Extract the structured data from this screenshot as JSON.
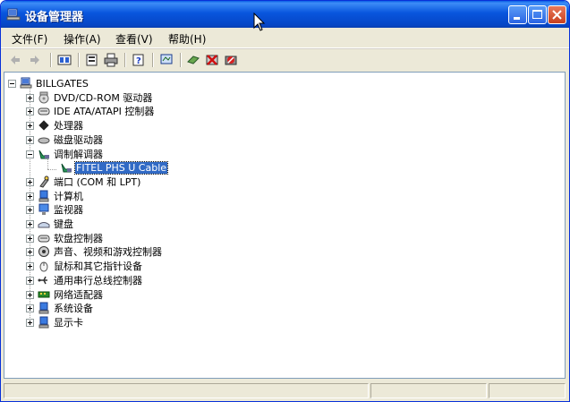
{
  "window": {
    "title": "设备管理器"
  },
  "menu": [
    {
      "label": "文件(F)"
    },
    {
      "label": "操作(A)"
    },
    {
      "label": "查看(V)"
    },
    {
      "label": "帮助(H)"
    }
  ],
  "toolbar": {
    "icons": [
      "back-icon",
      "forward-icon",
      "up-icon",
      "properties-icon",
      "print-icon",
      "help-icon",
      "scan-icon",
      "update-driver-icon",
      "uninstall-icon",
      "disable-icon"
    ]
  },
  "tree": {
    "root": "BILLGATES",
    "items": [
      {
        "label": "DVD/CD-ROM 驱动器",
        "icon": "cdrom-icon",
        "expander": "plus"
      },
      {
        "label": "IDE ATA/ATAPI 控制器",
        "icon": "ide-controller-icon",
        "expander": "plus"
      },
      {
        "label": "处理器",
        "icon": "processor-icon",
        "expander": "plus"
      },
      {
        "label": "磁盘驱动器",
        "icon": "disk-drive-icon",
        "expander": "plus"
      },
      {
        "label": "调制解调器",
        "icon": "modem-icon",
        "expander": "minus"
      },
      {
        "label": "FITEL PHS U Cable",
        "icon": "modem-icon",
        "expander": "none",
        "child": true,
        "selected": true
      },
      {
        "label": "端口 (COM 和 LPT)",
        "icon": "port-icon",
        "expander": "plus"
      },
      {
        "label": "计算机",
        "icon": "computer-icon",
        "expander": "plus"
      },
      {
        "label": "监视器",
        "icon": "monitor-icon",
        "expander": "plus"
      },
      {
        "label": "键盘",
        "icon": "keyboard-icon",
        "expander": "plus"
      },
      {
        "label": "软盘控制器",
        "icon": "floppy-controller-icon",
        "expander": "plus"
      },
      {
        "label": "声音、视频和游戏控制器",
        "icon": "sound-icon",
        "expander": "plus"
      },
      {
        "label": "鼠标和其它指针设备",
        "icon": "mouse-icon",
        "expander": "plus"
      },
      {
        "label": "通用串行总线控制器",
        "icon": "usb-icon",
        "expander": "plus"
      },
      {
        "label": "网络适配器",
        "icon": "network-adapter-icon",
        "expander": "plus"
      },
      {
        "label": "系统设备",
        "icon": "system-device-icon",
        "expander": "plus"
      },
      {
        "label": "显示卡",
        "icon": "display-adapter-icon",
        "expander": "plus"
      }
    ]
  },
  "colors": {
    "titlebar": "#0855dd",
    "selection": "#316ac5",
    "chrome": "#ece9d8"
  }
}
